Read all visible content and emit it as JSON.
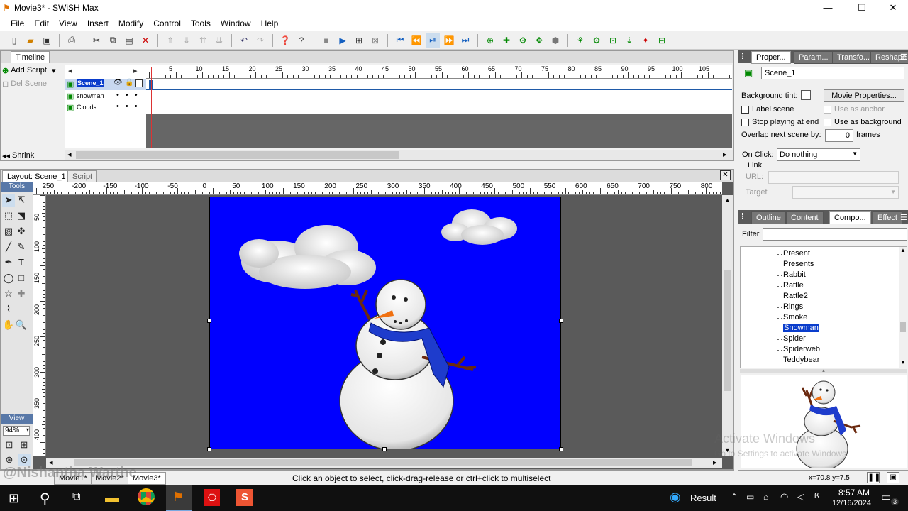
{
  "window": {
    "title": "Movie3* - SWiSH Max",
    "minimize": "—",
    "maximize": "☐",
    "close": "✕"
  },
  "menu": [
    "File",
    "Edit",
    "View",
    "Insert",
    "Modify",
    "Control",
    "Tools",
    "Window",
    "Help"
  ],
  "timeline": {
    "tab": "Timeline",
    "add_script": "Add Script",
    "del_scene": "Del Scene",
    "shrink": "Shrink",
    "frames": [
      "5",
      "10",
      "15",
      "20",
      "25",
      "30",
      "35",
      "40",
      "45",
      "50",
      "55",
      "60",
      "65",
      "70",
      "75",
      "80",
      "85",
      "90",
      "95",
      "100",
      "105"
    ],
    "layers": [
      {
        "name": "Scene_1"
      },
      {
        "name": "snowman"
      },
      {
        "name": "Clouds"
      }
    ]
  },
  "layout": {
    "tab": "Layout: Scene_1",
    "script_tab": "Script",
    "ruler_x": [
      "250",
      "-200",
      "-150",
      "-100",
      "-50",
      "0",
      "50",
      "100",
      "150",
      "200",
      "250",
      "300",
      "350",
      "400",
      "450",
      "500",
      "550",
      "600",
      "650",
      "700",
      "750",
      "800"
    ],
    "ruler_y": [
      "50",
      "100",
      "150",
      "200",
      "250",
      "300",
      "350",
      "400"
    ],
    "tools_label": "Tools",
    "view_label": "View",
    "zoom": "94%",
    "stage_color": "#0000ff"
  },
  "movie_tabs": [
    "Movie1*",
    "Movie2*",
    "Movie3*"
  ],
  "watermark": "@Nishantha Warthe",
  "properties": {
    "tabs": [
      "Proper...",
      "Param...",
      "Transfo...",
      "Reshape"
    ],
    "scene_name": "Scene_1",
    "bg_tint_label": "Background tint:",
    "movie_props_btn": "Movie Properties...",
    "label_scene": "Label scene",
    "use_anchor": "Use as anchor",
    "stop_end": "Stop playing at end",
    "use_bg": "Use as background",
    "overlap_label": "Overlap next scene by:",
    "overlap_value": "0",
    "frames_unit": "frames",
    "onclick_label": "On Click:",
    "onclick_value": "Do nothing",
    "link_label": "Link",
    "url_label": "URL:",
    "target_label": "Target"
  },
  "components": {
    "tabs": [
      "Outline",
      "Content",
      "Compo...",
      "Effect"
    ],
    "filter_label": "Filter",
    "items": [
      "Present",
      "Presents",
      "Rabbit",
      "Rattle",
      "Rattle2",
      "Rings",
      "Smoke",
      "Snowman",
      "Spider",
      "Spiderweb",
      "Teddybear"
    ],
    "selected": "Snowman"
  },
  "status": {
    "message": "Click an object to select, click-drag-release or ctrl+click to multiselect",
    "coords": "x=70.8 y=7.5",
    "activate_title": "Activate Windows",
    "activate_sub": "Go to Settings to activate Windows."
  },
  "taskbar": {
    "result": "Result",
    "time": "8:57 AM",
    "date": "12/16/2024",
    "notif": "3"
  }
}
